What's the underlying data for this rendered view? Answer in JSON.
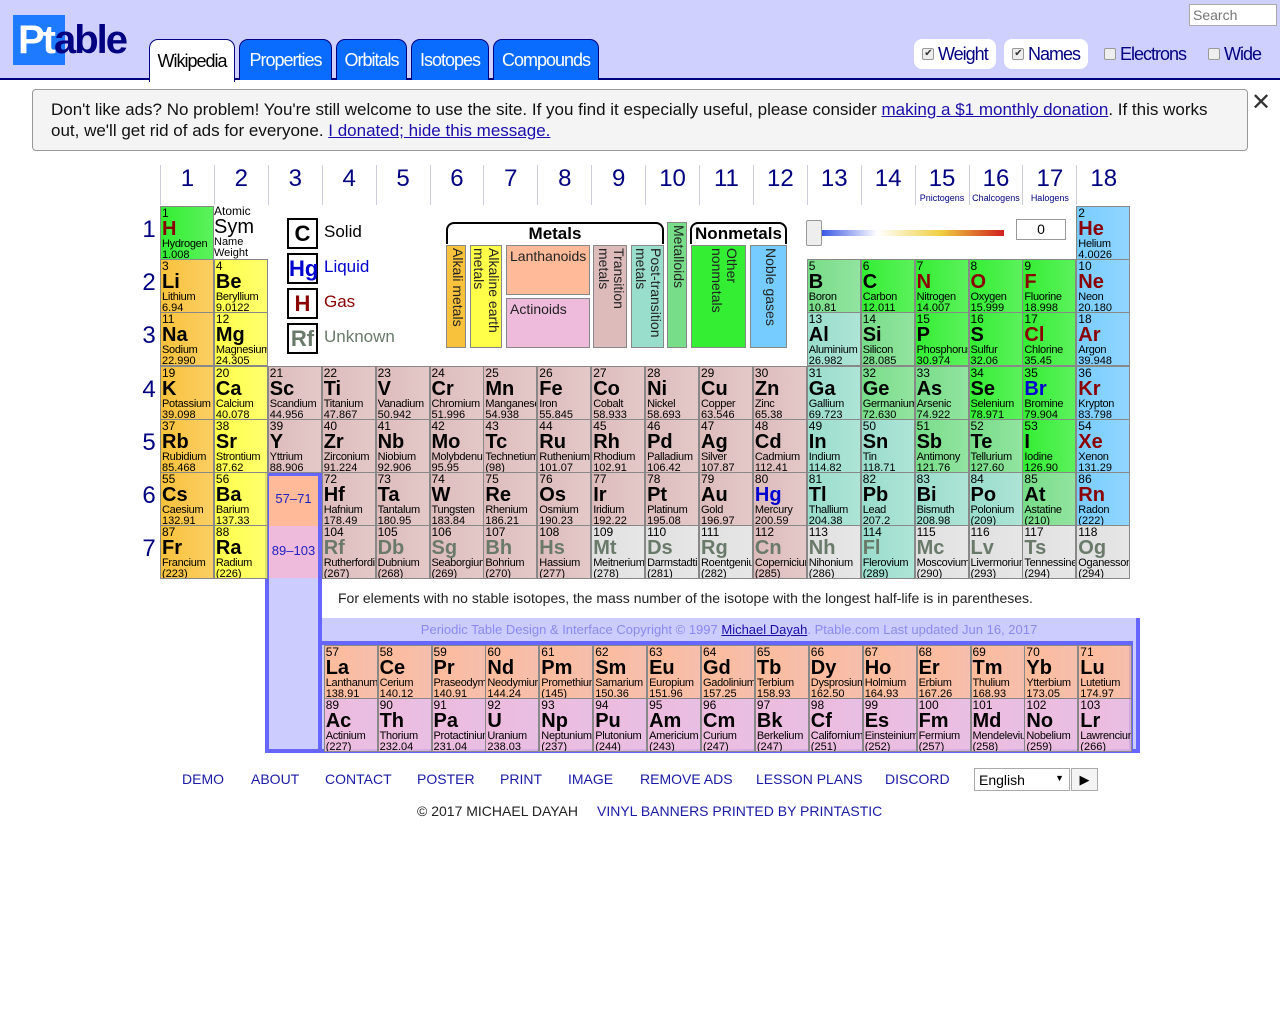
{
  "header": {
    "logo": "Ptable",
    "logo_prefix": "Pt",
    "logo_suffix": "able",
    "search_placeholder": "Search",
    "tabs": [
      {
        "label": "Wikipedia",
        "active": true
      },
      {
        "label": "Properties"
      },
      {
        "label": "Orbitals"
      },
      {
        "label": "Isotopes"
      },
      {
        "label": "Compounds"
      }
    ],
    "options": [
      {
        "label": "Weight",
        "checked": true
      },
      {
        "label": "Names",
        "checked": true
      },
      {
        "label": "Electrons",
        "checked": false
      },
      {
        "label": "Wide",
        "checked": false
      }
    ]
  },
  "ad": {
    "text1": "Don't like ads? No problem! You're still welcome to use the site. If you find it especially useful, please consider ",
    "link1": "making a $1 monthly donation",
    "text2": ". If this works out, we'll get rid of ads for everyone. ",
    "link2": "I donated; hide this message.",
    "close": "✕"
  },
  "groups": [
    "1",
    "2",
    "3",
    "4",
    "5",
    "6",
    "7",
    "8",
    "9",
    "10",
    "11",
    "12",
    "13",
    "14",
    "15",
    "16",
    "17",
    "18"
  ],
  "group_names": {
    "15": "Pnictogens",
    "16": "Chalcogens",
    "17": "Halogens"
  },
  "periods": [
    "1",
    "2",
    "3",
    "4",
    "5",
    "6",
    "7"
  ],
  "key": {
    "atomic": "Atomic",
    "sym": "Sym",
    "name": "Name",
    "weight": "Weight"
  },
  "states": [
    {
      "sym": "C",
      "label": "Solid",
      "color": "#000000"
    },
    {
      "sym": "Hg",
      "label": "Liquid",
      "color": "#0000d0"
    },
    {
      "sym": "H",
      "label": "Gas",
      "color": "#8a0000"
    },
    {
      "sym": "Rf",
      "label": "Unknown",
      "color": "#6a7a6a"
    }
  ],
  "categories": {
    "metals": "Metals",
    "nonmetals": "Nonmetals",
    "a": "Alkali metals",
    "ae": "Alkaline earth metals",
    "ln": "Lanthanoids",
    "an": "Actinoids",
    "tm": "Transition metals",
    "pt": "Post-transition metals",
    "md": "Metalloids",
    "nm": "Other nonmetals",
    "ng": "Noble gases"
  },
  "colors": {
    "a": "#f9c23c",
    "ae": "#ffff4a",
    "ln": "#ffbb99",
    "an": "#eebbdd",
    "tm": "#ddbbbb",
    "pt": "#99ddcc",
    "md": "#77dd88",
    "nm": "#33ee33",
    "ng": "#77ccff",
    "un": "#e0e0e0",
    "frame": "#6666ff",
    "frame_fill": "#ccccff"
  },
  "slider": {
    "value": "0"
  },
  "placeholders": {
    "lanthanides": "57–71",
    "actinides": "89–103"
  },
  "note": "For elements with no stable isotopes, the mass number of the isotope with the longest half-life is in parentheses.",
  "copyright": {
    "pre": "Periodic Table Design & Interface Copyright © 1997 ",
    "link": "Michael Dayah",
    "post": ". Ptable.com Last updated Jun 16, 2017"
  },
  "footer": {
    "links": [
      "DEMO",
      "ABOUT",
      "CONTACT",
      "POSTER",
      "PRINT",
      "IMAGE",
      "REMOVE ADS",
      "LESSON PLANS",
      "DISCORD"
    ],
    "language": "English",
    "go": "▶",
    "copy": "© 2017 MICHAEL DAYAH",
    "sponsor": "VINYL BANNERS PRINTED BY PRINTASTIC"
  },
  "elements": [
    [
      1,
      "H",
      "Hydrogen",
      "1.008",
      "nm",
      "g"
    ],
    [
      2,
      "He",
      "Helium",
      "4.0026",
      "ng",
      "g"
    ],
    [
      3,
      "Li",
      "Lithium",
      "6.94",
      "a",
      "s"
    ],
    [
      4,
      "Be",
      "Beryllium",
      "9.0122",
      "ae",
      "s"
    ],
    [
      5,
      "B",
      "Boron",
      "10.81",
      "md",
      "s"
    ],
    [
      6,
      "C",
      "Carbon",
      "12.011",
      "nm",
      "s"
    ],
    [
      7,
      "N",
      "Nitrogen",
      "14.007",
      "nm",
      "g"
    ],
    [
      8,
      "O",
      "Oxygen",
      "15.999",
      "nm",
      "g"
    ],
    [
      9,
      "F",
      "Fluorine",
      "18.998",
      "nm",
      "g"
    ],
    [
      10,
      "Ne",
      "Neon",
      "20.180",
      "ng",
      "g"
    ],
    [
      11,
      "Na",
      "Sodium",
      "22.990",
      "a",
      "s"
    ],
    [
      12,
      "Mg",
      "Magnesium",
      "24.305",
      "ae",
      "s"
    ],
    [
      13,
      "Al",
      "Aluminium",
      "26.982",
      "pt",
      "s"
    ],
    [
      14,
      "Si",
      "Silicon",
      "28.085",
      "md",
      "s"
    ],
    [
      15,
      "P",
      "Phosphorus",
      "30.974",
      "nm",
      "s"
    ],
    [
      16,
      "S",
      "Sulfur",
      "32.06",
      "nm",
      "s"
    ],
    [
      17,
      "Cl",
      "Chlorine",
      "35.45",
      "nm",
      "g"
    ],
    [
      18,
      "Ar",
      "Argon",
      "39.948",
      "ng",
      "g"
    ],
    [
      19,
      "K",
      "Potassium",
      "39.098",
      "a",
      "s"
    ],
    [
      20,
      "Ca",
      "Calcium",
      "40.078",
      "ae",
      "s"
    ],
    [
      21,
      "Sc",
      "Scandium",
      "44.956",
      "tm",
      "s"
    ],
    [
      22,
      "Ti",
      "Titanium",
      "47.867",
      "tm",
      "s"
    ],
    [
      23,
      "V",
      "Vanadium",
      "50.942",
      "tm",
      "s"
    ],
    [
      24,
      "Cr",
      "Chromium",
      "51.996",
      "tm",
      "s"
    ],
    [
      25,
      "Mn",
      "Manganese",
      "54.938",
      "tm",
      "s"
    ],
    [
      26,
      "Fe",
      "Iron",
      "55.845",
      "tm",
      "s"
    ],
    [
      27,
      "Co",
      "Cobalt",
      "58.933",
      "tm",
      "s"
    ],
    [
      28,
      "Ni",
      "Nickel",
      "58.693",
      "tm",
      "s"
    ],
    [
      29,
      "Cu",
      "Copper",
      "63.546",
      "tm",
      "s"
    ],
    [
      30,
      "Zn",
      "Zinc",
      "65.38",
      "tm",
      "s"
    ],
    [
      31,
      "Ga",
      "Gallium",
      "69.723",
      "pt",
      "s"
    ],
    [
      32,
      "Ge",
      "Germanium",
      "72.630",
      "md",
      "s"
    ],
    [
      33,
      "As",
      "Arsenic",
      "74.922",
      "md",
      "s"
    ],
    [
      34,
      "Se",
      "Selenium",
      "78.971",
      "nm",
      "s"
    ],
    [
      35,
      "Br",
      "Bromine",
      "79.904",
      "nm",
      "l"
    ],
    [
      36,
      "Kr",
      "Krypton",
      "83.798",
      "ng",
      "g"
    ],
    [
      37,
      "Rb",
      "Rubidium",
      "85.468",
      "a",
      "s"
    ],
    [
      38,
      "Sr",
      "Strontium",
      "87.62",
      "ae",
      "s"
    ],
    [
      39,
      "Y",
      "Yttrium",
      "88.906",
      "tm",
      "s"
    ],
    [
      40,
      "Zr",
      "Zirconium",
      "91.224",
      "tm",
      "s"
    ],
    [
      41,
      "Nb",
      "Niobium",
      "92.906",
      "tm",
      "s"
    ],
    [
      42,
      "Mo",
      "Molybdenum",
      "95.95",
      "tm",
      "s"
    ],
    [
      43,
      "Tc",
      "Technetium",
      "(98)",
      "tm",
      "s"
    ],
    [
      44,
      "Ru",
      "Ruthenium",
      "101.07",
      "tm",
      "s"
    ],
    [
      45,
      "Rh",
      "Rhodium",
      "102.91",
      "tm",
      "s"
    ],
    [
      46,
      "Pd",
      "Palladium",
      "106.42",
      "tm",
      "s"
    ],
    [
      47,
      "Ag",
      "Silver",
      "107.87",
      "tm",
      "s"
    ],
    [
      48,
      "Cd",
      "Cadmium",
      "112.41",
      "tm",
      "s"
    ],
    [
      49,
      "In",
      "Indium",
      "114.82",
      "pt",
      "s"
    ],
    [
      50,
      "Sn",
      "Tin",
      "118.71",
      "pt",
      "s"
    ],
    [
      51,
      "Sb",
      "Antimony",
      "121.76",
      "md",
      "s"
    ],
    [
      52,
      "Te",
      "Tellurium",
      "127.60",
      "md",
      "s"
    ],
    [
      53,
      "I",
      "Iodine",
      "126.90",
      "nm",
      "s"
    ],
    [
      54,
      "Xe",
      "Xenon",
      "131.29",
      "ng",
      "g"
    ],
    [
      55,
      "Cs",
      "Caesium",
      "132.91",
      "a",
      "s"
    ],
    [
      56,
      "Ba",
      "Barium",
      "137.33",
      "ae",
      "s"
    ],
    [
      57,
      "La",
      "Lanthanum",
      "138.91",
      "ln",
      "s"
    ],
    [
      58,
      "Ce",
      "Cerium",
      "140.12",
      "ln",
      "s"
    ],
    [
      59,
      "Pr",
      "Praseodymium",
      "140.91",
      "ln",
      "s"
    ],
    [
      60,
      "Nd",
      "Neodymium",
      "144.24",
      "ln",
      "s"
    ],
    [
      61,
      "Pm",
      "Promethium",
      "(145)",
      "ln",
      "s"
    ],
    [
      62,
      "Sm",
      "Samarium",
      "150.36",
      "ln",
      "s"
    ],
    [
      63,
      "Eu",
      "Europium",
      "151.96",
      "ln",
      "s"
    ],
    [
      64,
      "Gd",
      "Gadolinium",
      "157.25",
      "ln",
      "s"
    ],
    [
      65,
      "Tb",
      "Terbium",
      "158.93",
      "ln",
      "s"
    ],
    [
      66,
      "Dy",
      "Dysprosium",
      "162.50",
      "ln",
      "s"
    ],
    [
      67,
      "Ho",
      "Holmium",
      "164.93",
      "ln",
      "s"
    ],
    [
      68,
      "Er",
      "Erbium",
      "167.26",
      "ln",
      "s"
    ],
    [
      69,
      "Tm",
      "Thulium",
      "168.93",
      "ln",
      "s"
    ],
    [
      70,
      "Yb",
      "Ytterbium",
      "173.05",
      "ln",
      "s"
    ],
    [
      71,
      "Lu",
      "Lutetium",
      "174.97",
      "ln",
      "s"
    ],
    [
      72,
      "Hf",
      "Hafnium",
      "178.49",
      "tm",
      "s"
    ],
    [
      73,
      "Ta",
      "Tantalum",
      "180.95",
      "tm",
      "s"
    ],
    [
      74,
      "W",
      "Tungsten",
      "183.84",
      "tm",
      "s"
    ],
    [
      75,
      "Re",
      "Rhenium",
      "186.21",
      "tm",
      "s"
    ],
    [
      76,
      "Os",
      "Osmium",
      "190.23",
      "tm",
      "s"
    ],
    [
      77,
      "Ir",
      "Iridium",
      "192.22",
      "tm",
      "s"
    ],
    [
      78,
      "Pt",
      "Platinum",
      "195.08",
      "tm",
      "s"
    ],
    [
      79,
      "Au",
      "Gold",
      "196.97",
      "tm",
      "s"
    ],
    [
      80,
      "Hg",
      "Mercury",
      "200.59",
      "tm",
      "l"
    ],
    [
      81,
      "Tl",
      "Thallium",
      "204.38",
      "pt",
      "s"
    ],
    [
      82,
      "Pb",
      "Lead",
      "207.2",
      "pt",
      "s"
    ],
    [
      83,
      "Bi",
      "Bismuth",
      "208.98",
      "pt",
      "s"
    ],
    [
      84,
      "Po",
      "Polonium",
      "(209)",
      "pt",
      "s"
    ],
    [
      85,
      "At",
      "Astatine",
      "(210)",
      "md",
      "s"
    ],
    [
      86,
      "Rn",
      "Radon",
      "(222)",
      "ng",
      "g"
    ],
    [
      87,
      "Fr",
      "Francium",
      "(223)",
      "a",
      "s"
    ],
    [
      88,
      "Ra",
      "Radium",
      "(226)",
      "ae",
      "s"
    ],
    [
      89,
      "Ac",
      "Actinium",
      "(227)",
      "an",
      "s"
    ],
    [
      90,
      "Th",
      "Thorium",
      "232.04",
      "an",
      "s"
    ],
    [
      91,
      "Pa",
      "Protactinium",
      "231.04",
      "an",
      "s"
    ],
    [
      92,
      "U",
      "Uranium",
      "238.03",
      "an",
      "s"
    ],
    [
      93,
      "Np",
      "Neptunium",
      "(237)",
      "an",
      "s"
    ],
    [
      94,
      "Pu",
      "Plutonium",
      "(244)",
      "an",
      "s"
    ],
    [
      95,
      "Am",
      "Americium",
      "(243)",
      "an",
      "s"
    ],
    [
      96,
      "Cm",
      "Curium",
      "(247)",
      "an",
      "s"
    ],
    [
      97,
      "Bk",
      "Berkelium",
      "(247)",
      "an",
      "s"
    ],
    [
      98,
      "Cf",
      "Californium",
      "(251)",
      "an",
      "s"
    ],
    [
      99,
      "Es",
      "Einsteinium",
      "(252)",
      "an",
      "s"
    ],
    [
      100,
      "Fm",
      "Fermium",
      "(257)",
      "an",
      "s"
    ],
    [
      101,
      "Md",
      "Mendelevium",
      "(258)",
      "an",
      "s"
    ],
    [
      102,
      "No",
      "Nobelium",
      "(259)",
      "an",
      "s"
    ],
    [
      103,
      "Lr",
      "Lawrencium",
      "(266)",
      "an",
      "s"
    ],
    [
      104,
      "Rf",
      "Rutherfordium",
      "(267)",
      "tm",
      "u"
    ],
    [
      105,
      "Db",
      "Dubnium",
      "(268)",
      "tm",
      "u"
    ],
    [
      106,
      "Sg",
      "Seaborgium",
      "(269)",
      "tm",
      "u"
    ],
    [
      107,
      "Bh",
      "Bohrium",
      "(270)",
      "tm",
      "u"
    ],
    [
      108,
      "Hs",
      "Hassium",
      "(277)",
      "tm",
      "u"
    ],
    [
      109,
      "Mt",
      "Meitnerium",
      "(278)",
      "un",
      "u"
    ],
    [
      110,
      "Ds",
      "Darmstadtium",
      "(281)",
      "un",
      "u"
    ],
    [
      111,
      "Rg",
      "Roentgenium",
      "(282)",
      "un",
      "u"
    ],
    [
      112,
      "Cn",
      "Copernicium",
      "(285)",
      "tm",
      "u"
    ],
    [
      113,
      "Nh",
      "Nihonium",
      "(286)",
      "un",
      "u"
    ],
    [
      114,
      "Fl",
      "Flerovium",
      "(289)",
      "pt",
      "u"
    ],
    [
      115,
      "Mc",
      "Moscovium",
      "(290)",
      "un",
      "u"
    ],
    [
      116,
      "Lv",
      "Livermorium",
      "(293)",
      "un",
      "u"
    ],
    [
      117,
      "Ts",
      "Tennessine",
      "(294)",
      "un",
      "u"
    ],
    [
      118,
      "Og",
      "Oganesson",
      "(294)",
      "un",
      "u"
    ]
  ]
}
